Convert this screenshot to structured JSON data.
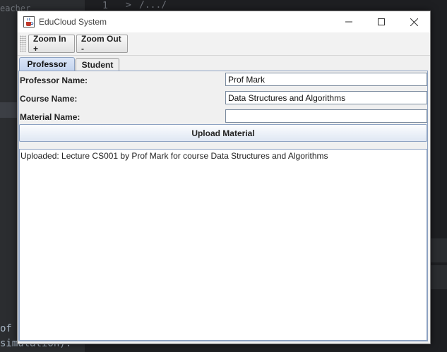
{
  "background": {
    "sidebar_text": "eacher",
    "editor_line_number": "1",
    "editor_fold": ">",
    "editor_text": "/.../",
    "bottom_line1": "of",
    "bottom_line2": "simulation)."
  },
  "window": {
    "title": "EduCloud System",
    "icons": {
      "app": "java-cup-icon",
      "minimize": "minimize-icon",
      "maximize": "maximize-icon",
      "close": "close-icon"
    }
  },
  "toolbar": {
    "zoom_in_label": "Zoom In +",
    "zoom_out_label": "Zoom Out -"
  },
  "tabs": [
    {
      "label": "Professor",
      "active": true
    },
    {
      "label": "Student",
      "active": false
    }
  ],
  "form": {
    "professor_name_label": "Professor Name:",
    "professor_name_value": "Prof Mark",
    "course_name_label": "Course Name:",
    "course_name_value": "Data Structures and  Algorithms",
    "material_name_label": "Material Name:",
    "material_name_value": "",
    "upload_label": "Upload Material"
  },
  "log": {
    "text": "Uploaded: Lecture CS001 by Prof Mark for course Data Structures and  Algorithms"
  },
  "colors": {
    "tab_active": "#c3d4ee",
    "panel_border": "#8da2c2",
    "window_bg": "#f0f0f0",
    "desktop_bg": "#1e1f22"
  }
}
